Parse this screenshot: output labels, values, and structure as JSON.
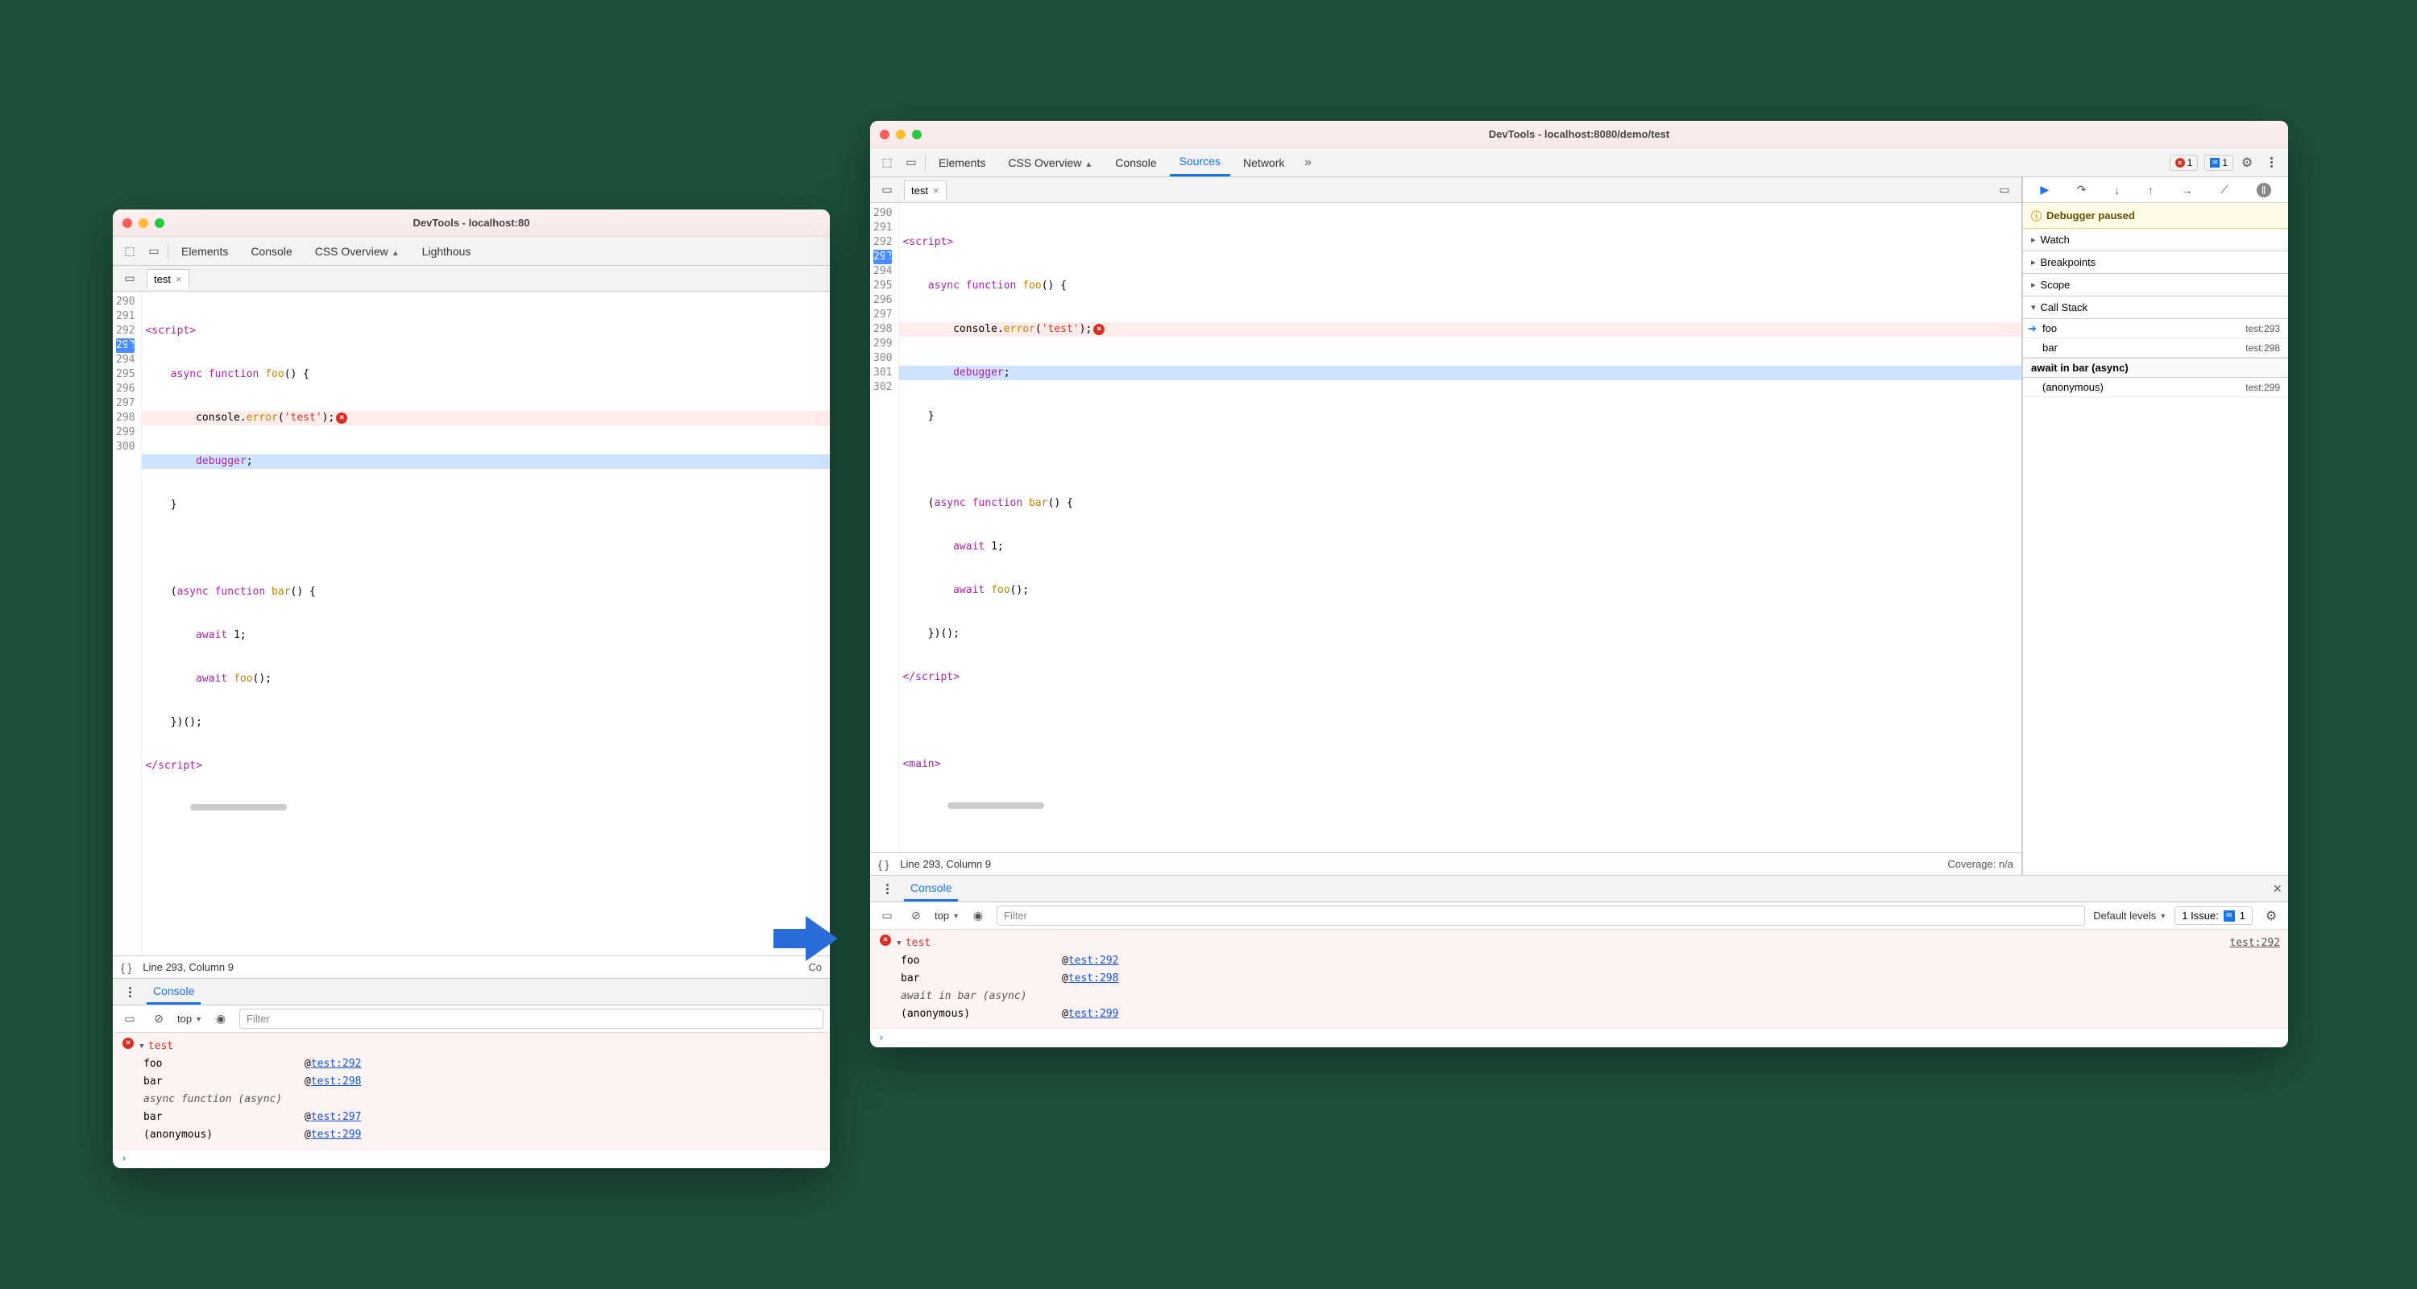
{
  "left_window": {
    "title": "DevTools - localhost:80",
    "tabs": [
      "Elements",
      "Console",
      "CSS Overview",
      "Lighthous"
    ],
    "file_tab": "test",
    "gutter_lines": [
      "290",
      "291",
      "292",
      "293",
      "294",
      "295",
      "296",
      "297",
      "298",
      "299",
      "300"
    ],
    "highlighted_line": "293",
    "code": {
      "l290": "<script>",
      "l291a": "    async function ",
      "l291b": "foo",
      "l291c": "() {",
      "l292a": "        console.",
      "l292b": "error",
      "l292c": "(",
      "l292d": "'test'",
      "l292e": ");",
      "l293a": "        debugger",
      "l293b": ";",
      "l294": "    }",
      "l295": "",
      "l296a": "    (",
      "l296b": "async function ",
      "l296c": "bar",
      "l296d": "() {",
      "l297a": "        await ",
      "l297b": "1;",
      "l298a": "        await ",
      "l298b": "foo",
      "l298c": "();",
      "l299": "    })();",
      "l300": "</script>"
    },
    "status": "Line 293, Column 9",
    "status_right": "Co",
    "console_label": "Console",
    "context": "top",
    "filter_ph": "Filter",
    "err_msg": "test",
    "trace": [
      {
        "fn": "foo",
        "at": "@",
        "loc": "test:292"
      },
      {
        "fn": "bar",
        "at": "@",
        "loc": "test:298"
      },
      {
        "label": "async function (async)"
      },
      {
        "fn": "bar",
        "at": "@",
        "loc": "test:297"
      },
      {
        "fn": "(anonymous)",
        "at": "@",
        "loc": "test:299"
      }
    ]
  },
  "right_window": {
    "title": "DevTools - localhost:8080/demo/test",
    "tabs": [
      "Elements",
      "CSS Overview",
      "Console",
      "Sources",
      "Network"
    ],
    "active_tab": "Sources",
    "err_count": "1",
    "msg_count": "1",
    "file_tab": "test",
    "gutter_lines": [
      "290",
      "291",
      "292",
      "293",
      "294",
      "295",
      "296",
      "297",
      "298",
      "299",
      "300",
      "301",
      "302"
    ],
    "highlighted_line": "293",
    "code": {
      "l290": "<script>",
      "l291a": "    async function ",
      "l291b": "foo",
      "l291c": "() {",
      "l292a": "        console.",
      "l292b": "error",
      "l292c": "(",
      "l292d": "'test'",
      "l292e": ");",
      "l293a": "        debugger",
      "l293b": ";",
      "l294": "    }",
      "l295": "",
      "l296a": "    (",
      "l296b": "async function ",
      "l296c": "bar",
      "l296d": "() {",
      "l297a": "        await ",
      "l297b": "1;",
      "l298a": "        await ",
      "l298b": "foo",
      "l298c": "();",
      "l299": "    })();",
      "l300": "</script>",
      "l301": "",
      "l302": "<main>"
    },
    "status": "Line 293, Column 9",
    "coverage": "Coverage: n/a",
    "paused": "Debugger paused",
    "panes": {
      "watch": "Watch",
      "breakpoints": "Breakpoints",
      "scope": "Scope",
      "callstack": "Call Stack"
    },
    "callstack": [
      {
        "fn": "foo",
        "loc": "test:293",
        "current": true
      },
      {
        "fn": "bar",
        "loc": "test:298"
      }
    ],
    "cs_async_hdr": "await in bar (async)",
    "cs_tail": [
      {
        "fn": "(anonymous)",
        "loc": "test:299"
      }
    ],
    "console_label": "Console",
    "context": "top",
    "filter_ph": "Filter",
    "levels": "Default levels",
    "issue_label": "1 Issue:",
    "issue_count": "1",
    "err_msg": "test",
    "err_src": "test:292",
    "trace": [
      {
        "fn": "foo",
        "at": "@",
        "loc": "test:292"
      },
      {
        "fn": "bar",
        "at": "@",
        "loc": "test:298"
      },
      {
        "label": "await in bar (async)"
      },
      {
        "fn": "(anonymous)",
        "at": "@",
        "loc": "test:299"
      }
    ]
  }
}
